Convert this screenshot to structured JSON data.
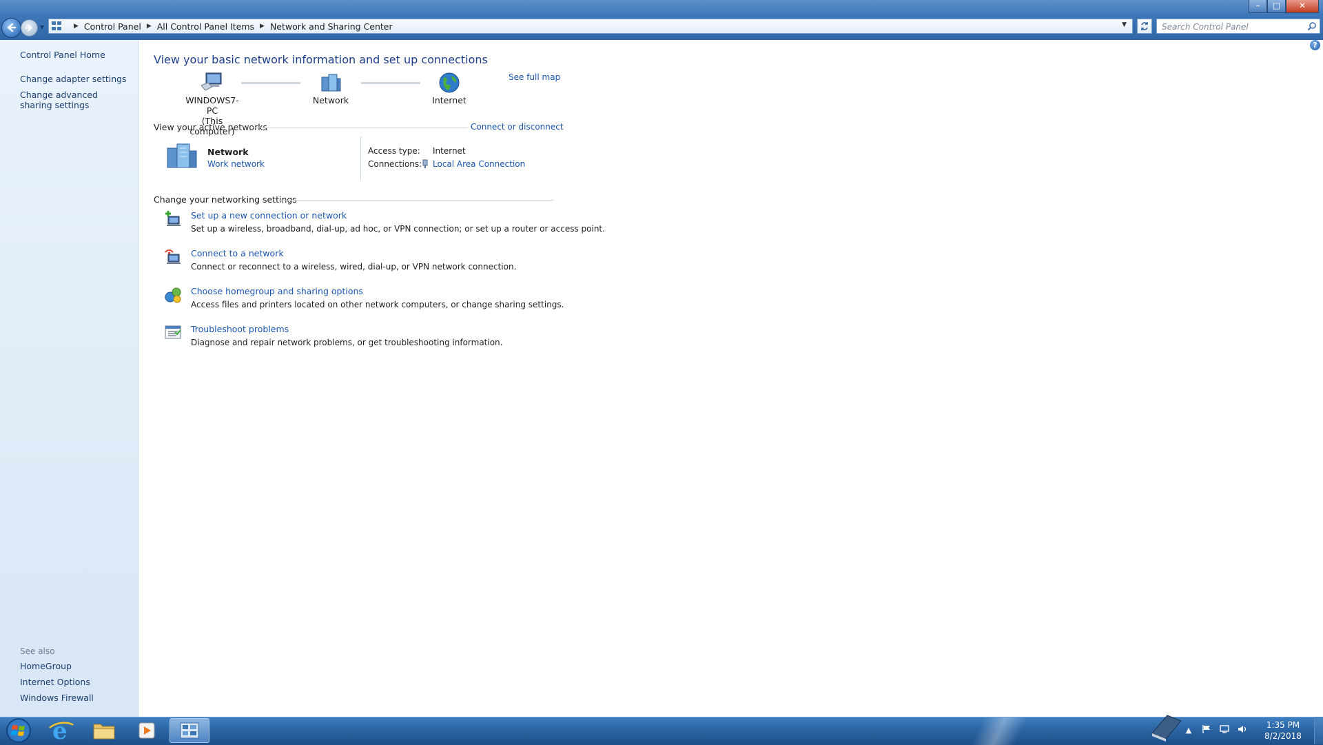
{
  "breadcrumb": [
    "Control Panel",
    "All Control Panel Items",
    "Network and Sharing Center"
  ],
  "search": {
    "placeholder": "Search Control Panel"
  },
  "window_controls": {
    "minimize": "–",
    "maximize": "□",
    "close": "✕"
  },
  "help_label": "?",
  "left_pane": {
    "home": "Control Panel Home",
    "links": [
      "Change adapter settings",
      "Change advanced sharing settings"
    ],
    "see_also_heading": "See also",
    "see_also": [
      "HomeGroup",
      "Internet Options",
      "Windows Firewall"
    ]
  },
  "main": {
    "title": "View your basic network information and set up connections",
    "map": {
      "computer": "WINDOWS7-PC",
      "computer_sub": "(This computer)",
      "network": "Network",
      "internet": "Internet",
      "see_full_map": "See full map"
    },
    "active_networks": {
      "heading": "View your active networks",
      "connect_link": "Connect or disconnect",
      "network_name": "Network",
      "network_type": "Work network",
      "access_type_label": "Access type:",
      "access_type_value": "Internet",
      "connections_label": "Connections:",
      "connections_value": "Local Area Connection"
    },
    "settings": {
      "heading": "Change your networking settings",
      "tasks": [
        {
          "link": "Set up a new connection or network",
          "desc": "Set up a wireless, broadband, dial-up, ad hoc, or VPN connection; or set up a router or access point."
        },
        {
          "link": "Connect to a network",
          "desc": "Connect or reconnect to a wireless, wired, dial-up, or VPN network connection."
        },
        {
          "link": "Choose homegroup and sharing options",
          "desc": "Access files and printers located on other network computers, or change sharing settings."
        },
        {
          "link": "Troubleshoot problems",
          "desc": "Diagnose and repair network problems, or get troubleshooting information."
        }
      ]
    }
  },
  "taskbar": {
    "time": "1:35 PM",
    "date": "8/2/2018",
    "tray_icons": [
      "show-hidden-icons",
      "action-center-flag-icon",
      "network-icon",
      "volume-icon"
    ]
  },
  "colors": {
    "link": "#1a55b0",
    "title": "#1e3f8c",
    "taskbar": "#2c66a6"
  }
}
